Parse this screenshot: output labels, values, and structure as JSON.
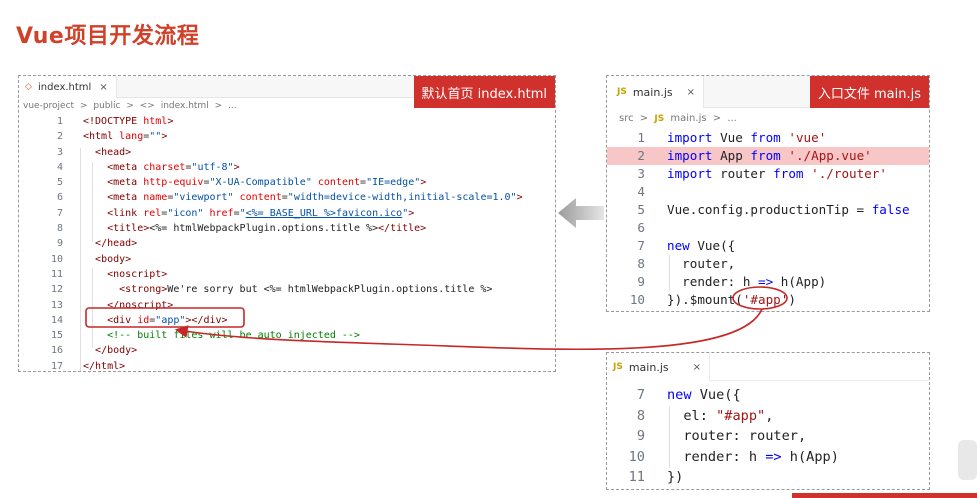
{
  "page_title": "Vue项目开发流程",
  "html_panel": {
    "tab_label": "index.html",
    "tab_close": "×",
    "breadcrumb": [
      "vue-project",
      ">",
      "public",
      ">",
      "<>",
      "index.html",
      ">",
      "..."
    ],
    "label": "默认首页 index.html",
    "lines": [
      {
        "n": "1",
        "code": "<!DOCTYPE html>"
      },
      {
        "n": "2",
        "code": "<html lang=\"\">"
      },
      {
        "n": "3",
        "code": "  <head>"
      },
      {
        "n": "4",
        "code": "    <meta charset=\"utf-8\">"
      },
      {
        "n": "5",
        "code": "    <meta http-equiv=\"X-UA-Compatible\" content=\"IE=edge\">"
      },
      {
        "n": "6",
        "code": "    <meta name=\"viewport\" content=\"width=device-width,initial-scale=1.0\">"
      },
      {
        "n": "7",
        "code": "    <link rel=\"icon\" href=\"<%= BASE_URL %>favicon.ico\">"
      },
      {
        "n": "8",
        "code": "    <title><%= htmlWebpackPlugin.options.title %></title>"
      },
      {
        "n": "9",
        "code": "  </head>"
      },
      {
        "n": "10",
        "code": "  <body>"
      },
      {
        "n": "11",
        "code": "    <noscript>"
      },
      {
        "n": "12",
        "code": "      <strong>We're sorry but <%= htmlWebpackPlugin.options.title %>"
      },
      {
        "n": "13",
        "code": "    </noscript>"
      },
      {
        "n": "14",
        "code": "    <div id=\"app\"></div>"
      },
      {
        "n": "15",
        "code": "    <!-- built files will be auto injected -->"
      },
      {
        "n": "16",
        "code": "  </body>"
      },
      {
        "n": "17",
        "code": "</html>"
      }
    ]
  },
  "main_panel": {
    "tab_label": "main.js",
    "tab_badge": "JS",
    "tab_close": "×",
    "breadcrumb": [
      "src",
      ">",
      "JS",
      "main.js",
      ">",
      "..."
    ],
    "label": "入口文件 main.js",
    "lines": [
      {
        "n": "1",
        "code": "import Vue from 'vue'"
      },
      {
        "n": "2",
        "code": "import App from './App.vue'"
      },
      {
        "n": "3",
        "code": "import router from './router'"
      },
      {
        "n": "4",
        "code": ""
      },
      {
        "n": "5",
        "code": "Vue.config.productionTip = false"
      },
      {
        "n": "6",
        "code": ""
      },
      {
        "n": "7",
        "code": "new Vue({"
      },
      {
        "n": "8",
        "code": "  router,"
      },
      {
        "n": "9",
        "code": "  render: h => h(App)"
      },
      {
        "n": "10",
        "code": "}).$mount('#app')"
      }
    ],
    "highlighted_line": "2"
  },
  "alt_panel": {
    "tab_label": "main.js",
    "tab_badge": "JS",
    "tab_close": "×",
    "lines": [
      {
        "n": "7",
        "code": "new Vue({"
      },
      {
        "n": "8",
        "code": "  el: \"#app\","
      },
      {
        "n": "9",
        "code": "  router: router,"
      },
      {
        "n": "10",
        "code": "  render: h => h(App)"
      },
      {
        "n": "11",
        "code": "})"
      }
    ]
  },
  "colors": {
    "accent_red": "#d0312d",
    "title_red": "#d0412a",
    "highlight": "#f7c6c6",
    "keyword": "#0000ff",
    "string": "#a31515"
  }
}
